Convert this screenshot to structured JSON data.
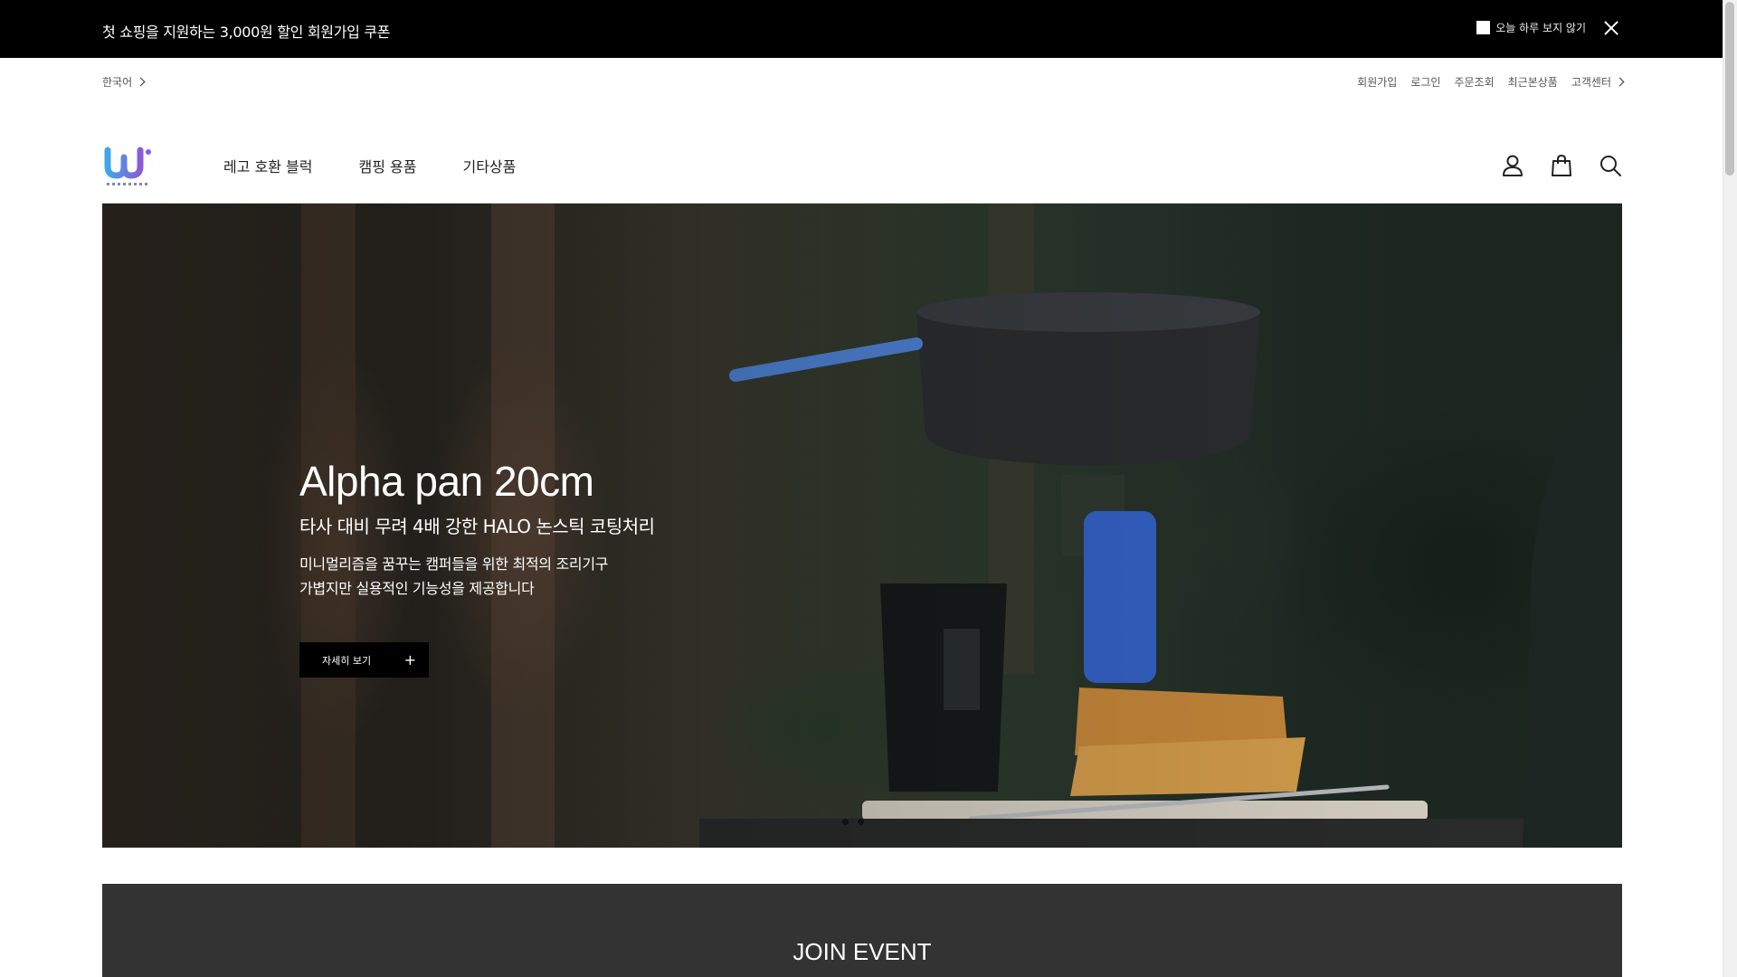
{
  "promo": {
    "text": "첫 쇼핑을 지원하는 3,000원 할인 회원가입 쿠폰",
    "hide_today_label": "오늘 하루 보지 않기"
  },
  "utility": {
    "language": "한국어",
    "links": [
      "회원가입",
      "로그인",
      "주문조회",
      "최근본상품",
      "고객센터"
    ]
  },
  "header": {
    "nav": [
      "레고 호환 블럭",
      "캠핑 용품",
      "기타상품"
    ],
    "icons": [
      "user-icon",
      "shopping-bag-icon",
      "search-icon"
    ],
    "logo_text": "WAWAMALL"
  },
  "hero": {
    "title": "Alpha pan 20cm",
    "subtitle": "타사 대비 무려 4배 강한 HALO 논스틱 코팅처리",
    "desc_line1": "미니멀리즘을 꿈꾸는 캠퍼들을 위한 최적의 조리기구",
    "desc_line2": "가볍지만 실용적인 기능성을 제공합니다",
    "button_label": "자세히 보기"
  },
  "join_event": {
    "title": "JOIN EVENT"
  },
  "colors": {
    "promo_bg": "#000000",
    "join_bg": "#333333",
    "logo_blue": "#3fa7e8",
    "logo_purple": "#8a5bd6"
  }
}
